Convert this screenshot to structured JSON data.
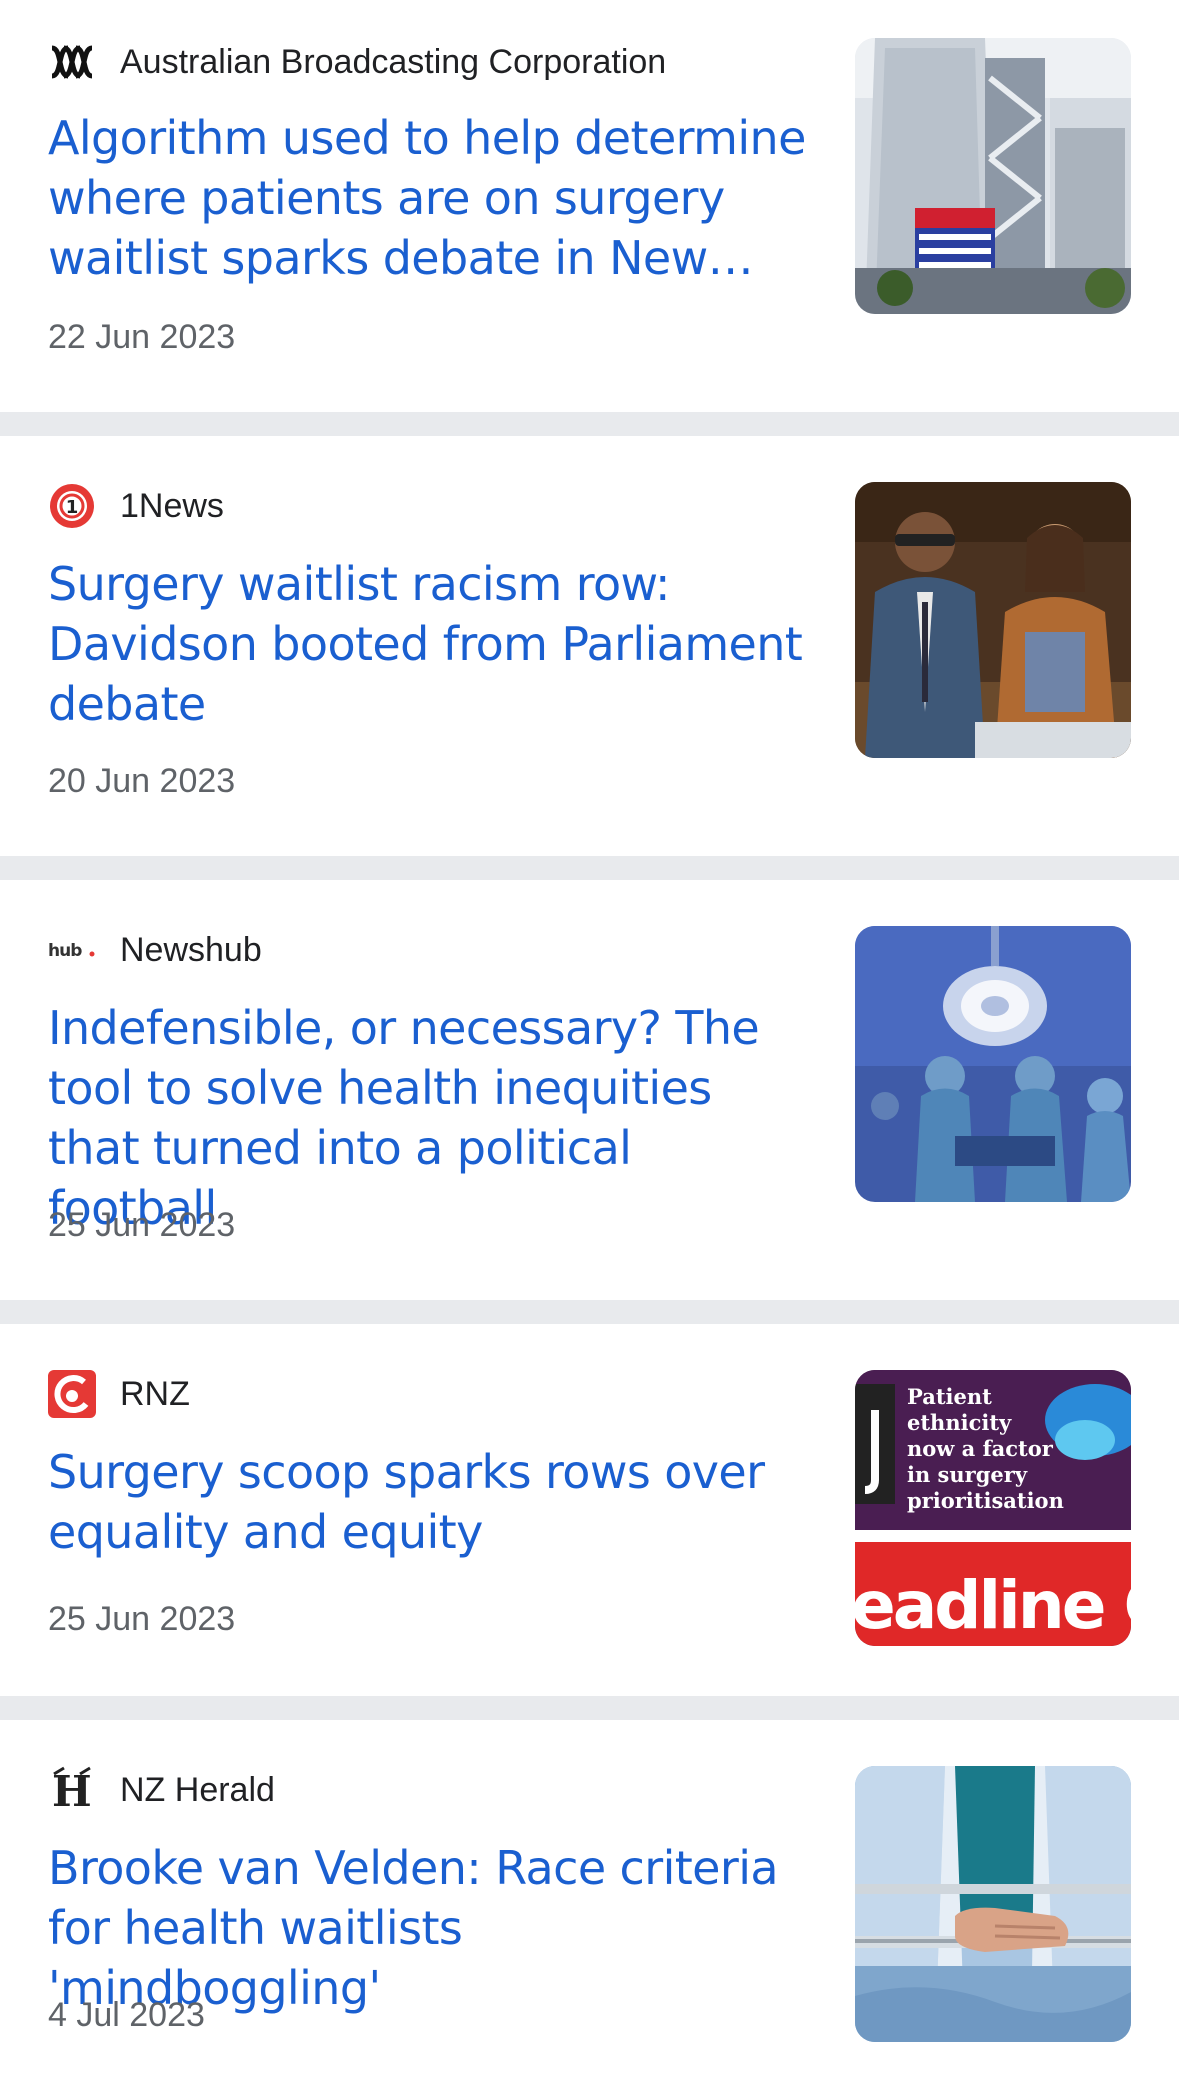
{
  "articles": [
    {
      "source": "Australian Broadcasting Corporation",
      "source_icon": "abc-logo-icon",
      "headline": "Algorithm used to help determine where patients are on surgery waitlist sparks debate in New…",
      "date": "22 Jun 2023",
      "thumbnail": "hospital-building-image"
    },
    {
      "source": "1News",
      "source_icon": "1news-logo-icon",
      "headline": "Surgery waitlist racism row: Davidson booted from Parliament debate",
      "date": "20 Jun 2023",
      "thumbnail": "parliament-image"
    },
    {
      "source": "Newshub",
      "source_icon": "newshub-logo-icon",
      "headline": "Indefensible, or necessary? The tool to solve health inequities that turned into a political football",
      "date": "25 Jun 2023",
      "thumbnail": "operating-theatre-image"
    },
    {
      "source": "RNZ",
      "source_icon": "rnz-logo-icon",
      "headline": "Surgery scoop sparks rows over equality and equity",
      "date": "25 Jun 2023",
      "thumbnail": "newspaper-headline-image",
      "thumbnail_text": {
        "line1": "Patient",
        "line2": "ethnicity",
        "line3": "now a factor",
        "line4": "in surgery",
        "line5": "prioritisation",
        "banner": "eadline Grab"
      }
    },
    {
      "source": "NZ Herald",
      "source_icon": "nzherald-logo-icon",
      "headline": "Brooke van Velden: Race criteria for health waitlists 'mindboggling'",
      "date": "4 Jul 2023",
      "thumbnail": "hospital-bed-image"
    }
  ],
  "colors": {
    "headline": "#1a5fd0",
    "source_text": "#202124",
    "date_text": "#5f6368",
    "divider": "#e8eaed"
  }
}
